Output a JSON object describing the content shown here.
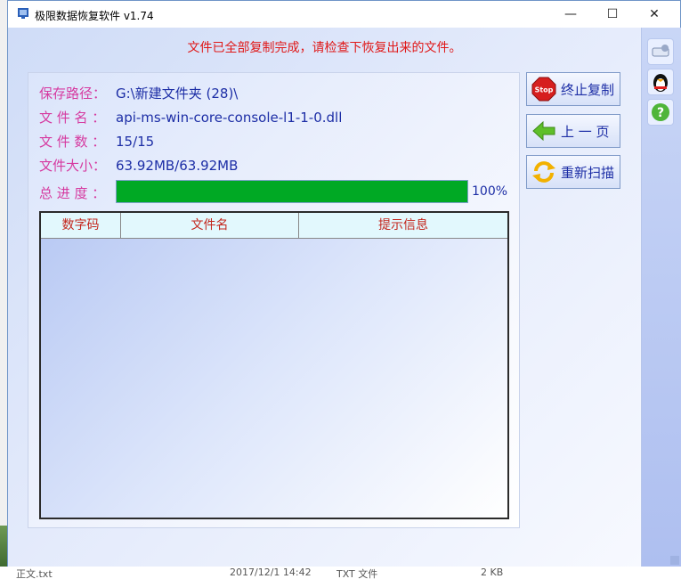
{
  "window": {
    "title": "极限数据恢复软件 v1.74",
    "minimize_symbol": "—",
    "maximize_symbol": "☐",
    "close_symbol": "✕"
  },
  "headline": "文件已全部复制完成，请检查下恢复出来的文件。",
  "info": {
    "save_path_label": "保存路径：",
    "save_path_value": "G:\\新建文件夹 (28)\\",
    "file_name_label": "文 件 名 ：",
    "file_name_value": "api-ms-win-core-console-l1-1-0.dll",
    "file_count_label": "文 件 数 ：",
    "file_count_value": "15/15",
    "file_size_label": "文件大小：",
    "file_size_value": "63.92MB/63.92MB",
    "progress_label": "总 进 度 ：",
    "progress_fraction": 1.0,
    "progress_text": "100%"
  },
  "table": {
    "columns": [
      "数字码",
      "文件名",
      "提示信息"
    ],
    "rows": []
  },
  "buttons": {
    "stop_label": "终止复制",
    "stop_icon_text": "Stop",
    "prev_label": "上 一 页",
    "rescan_label": "重新扫描"
  },
  "side_icons": [
    "settings-icon",
    "qq-penguin-icon",
    "help-icon"
  ],
  "background_strip": {
    "name": "正文.txt",
    "date": "2017/12/1 14:42",
    "type": "TXT 文件",
    "size": "2 KB"
  },
  "colors": {
    "headline": "#e01919",
    "label": "#d63aa0",
    "value": "#1d2ea6",
    "progress_fill": "#00a924",
    "header_text": "#c4261d"
  }
}
